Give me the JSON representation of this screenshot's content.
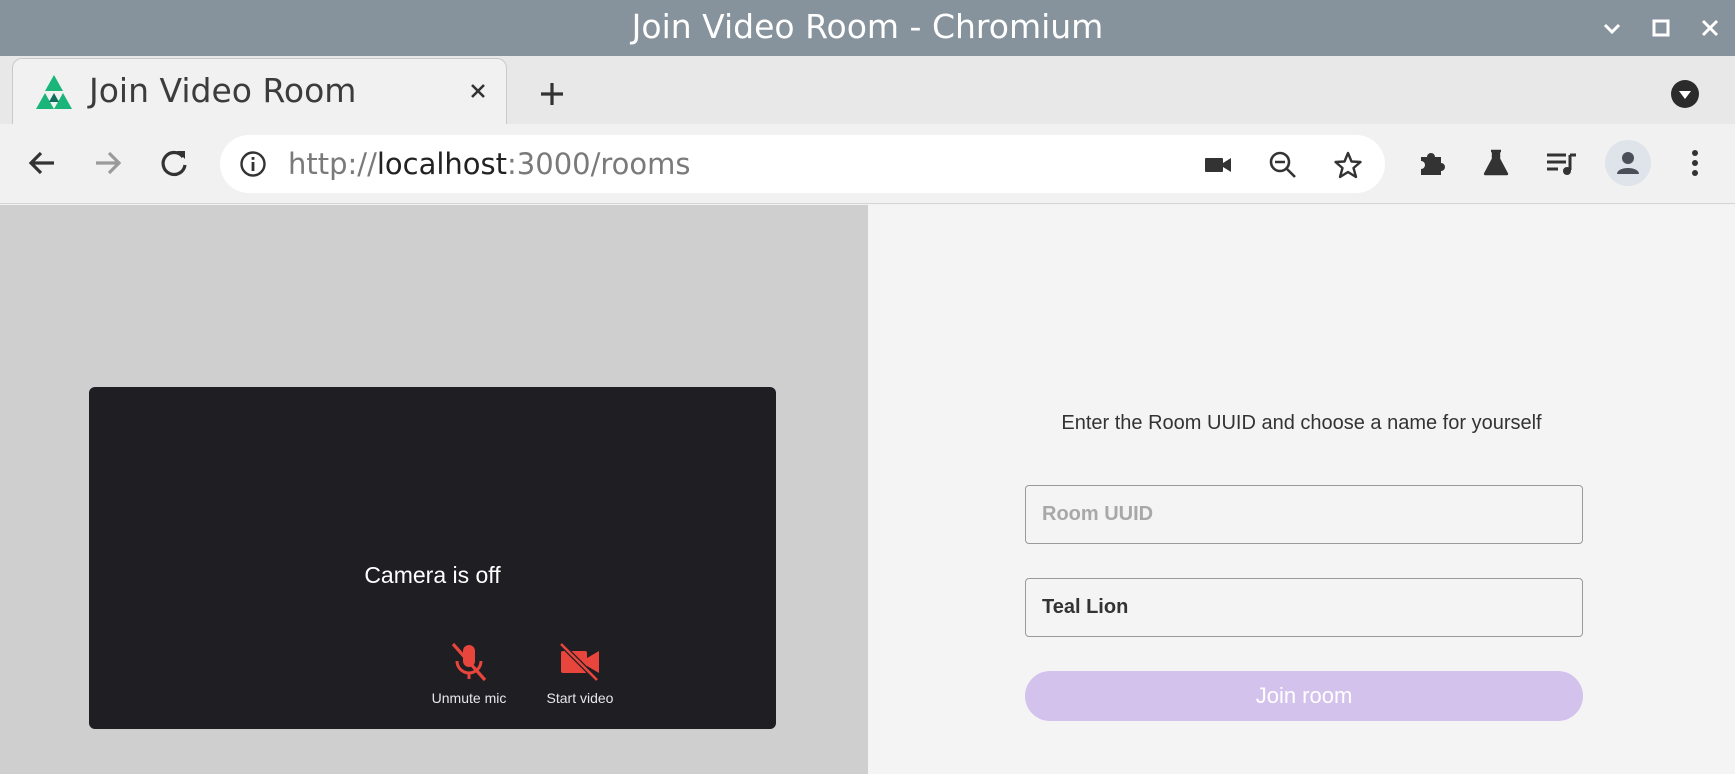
{
  "window": {
    "title": "Join Video Room - Chromium",
    "controls": [
      "minimize",
      "maximize",
      "close"
    ]
  },
  "tab": {
    "title": "Join Video Room",
    "favicon": "triangle-logo-icon",
    "colors": {
      "favicon_green": "#1bb57a",
      "favicon_dark": "#0f6e5b"
    }
  },
  "toolbar": {
    "url_scheme": "http://",
    "url_host": "localhost",
    "url_rest": ":3000/rooms",
    "icons": [
      "back-icon",
      "forward-icon",
      "reload-icon",
      "info-icon",
      "camera-icon",
      "zoom-out-icon",
      "star-icon",
      "extensions-icon",
      "labs-icon",
      "media-queue-icon",
      "profile-icon",
      "menu-icon"
    ]
  },
  "preview": {
    "status": "Camera is off",
    "mic_label": "Unmute mic",
    "video_label": "Start video",
    "accent": "#e8453c"
  },
  "form": {
    "instruction": "Enter the Room UUID and choose a name for yourself",
    "room_placeholder": "Room UUID",
    "room_value": "",
    "name_value": "Teal Lion",
    "join_label": "Join room",
    "join_color": "#d3c2ec"
  }
}
